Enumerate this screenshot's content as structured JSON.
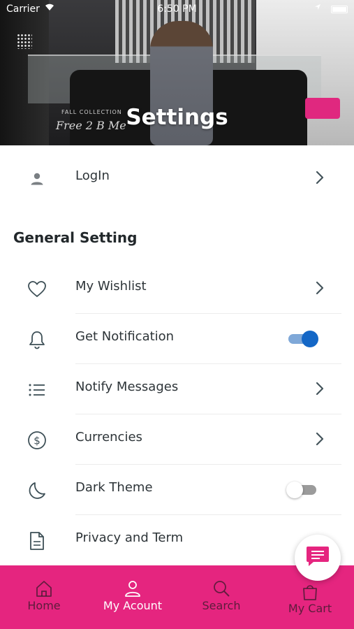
{
  "status_bar": {
    "carrier": "Carrier",
    "time": "6:50 PM"
  },
  "header": {
    "title": "Settings",
    "banner_small_text": "FALL COLLECTION",
    "banner_script_text": "Free 2 B Me"
  },
  "login": {
    "label": "LogIn",
    "icon": "person-icon"
  },
  "general": {
    "title": "General Setting",
    "items": [
      {
        "label": "My Wishlist",
        "icon": "heart-icon",
        "control": "chevron"
      },
      {
        "label": "Get Notification",
        "icon": "bell-icon",
        "control": "toggle",
        "on": true
      },
      {
        "label": "Notify Messages",
        "icon": "list-icon",
        "control": "chevron"
      },
      {
        "label": "Currencies",
        "icon": "dollar-icon",
        "control": "chevron"
      },
      {
        "label": "Dark Theme",
        "icon": "moon-icon",
        "control": "toggle",
        "on": false
      },
      {
        "label": "Privacy and Term",
        "icon": "document-icon",
        "control": "none"
      }
    ]
  },
  "bottom_nav": {
    "items": [
      {
        "label": "Home",
        "icon": "home-icon"
      },
      {
        "label": "My Acount",
        "icon": "user-icon"
      },
      {
        "label": "Search",
        "icon": "search-icon"
      },
      {
        "label": "My Cart",
        "icon": "bag-icon"
      }
    ]
  },
  "colors": {
    "accent": "#e5257f",
    "toggle_on": "#1467c6",
    "icon": "#3d4f56",
    "text": "#2d3438"
  },
  "fab": {
    "icon": "chat-icon"
  }
}
